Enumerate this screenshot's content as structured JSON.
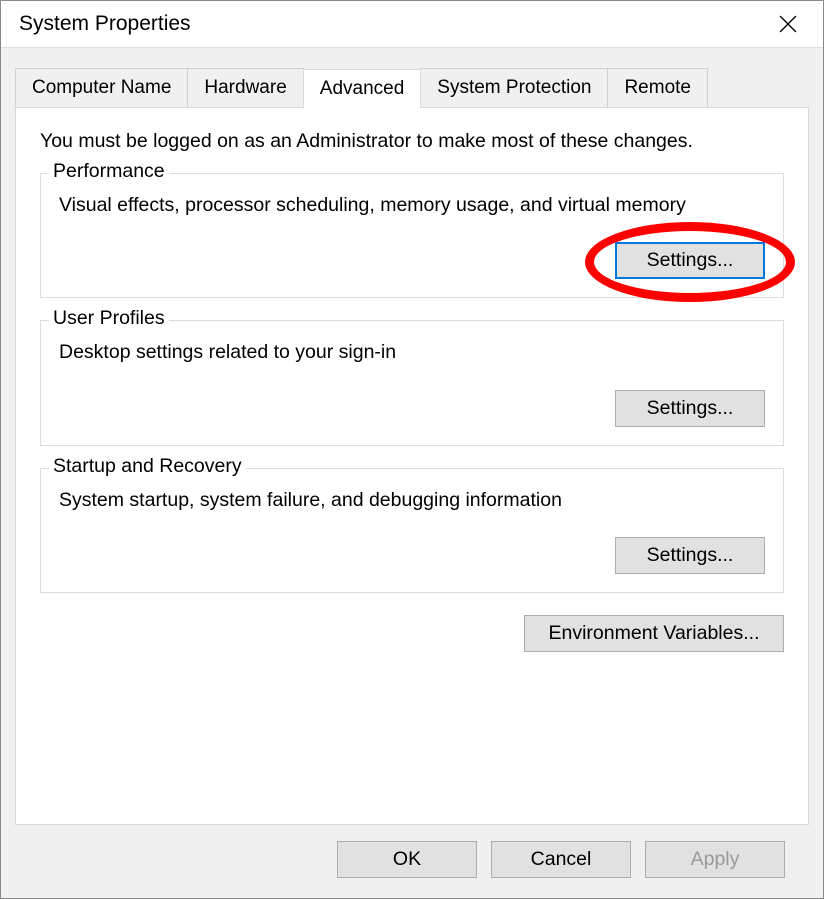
{
  "window": {
    "title": "System Properties"
  },
  "tabs": [
    {
      "label": "Computer Name"
    },
    {
      "label": "Hardware"
    },
    {
      "label": "Advanced"
    },
    {
      "label": "System Protection"
    },
    {
      "label": "Remote"
    }
  ],
  "intro": "You must be logged on as an Administrator to make most of these changes.",
  "performance": {
    "title": "Performance",
    "desc": "Visual effects, processor scheduling, memory usage, and virtual memory",
    "button": "Settings..."
  },
  "userProfiles": {
    "title": "User Profiles",
    "desc": "Desktop settings related to your sign-in",
    "button": "Settings..."
  },
  "startupRecovery": {
    "title": "Startup and Recovery",
    "desc": "System startup, system failure, and debugging information",
    "button": "Settings..."
  },
  "envVars": {
    "button": "Environment Variables..."
  },
  "footer": {
    "ok": "OK",
    "cancel": "Cancel",
    "apply": "Apply"
  }
}
